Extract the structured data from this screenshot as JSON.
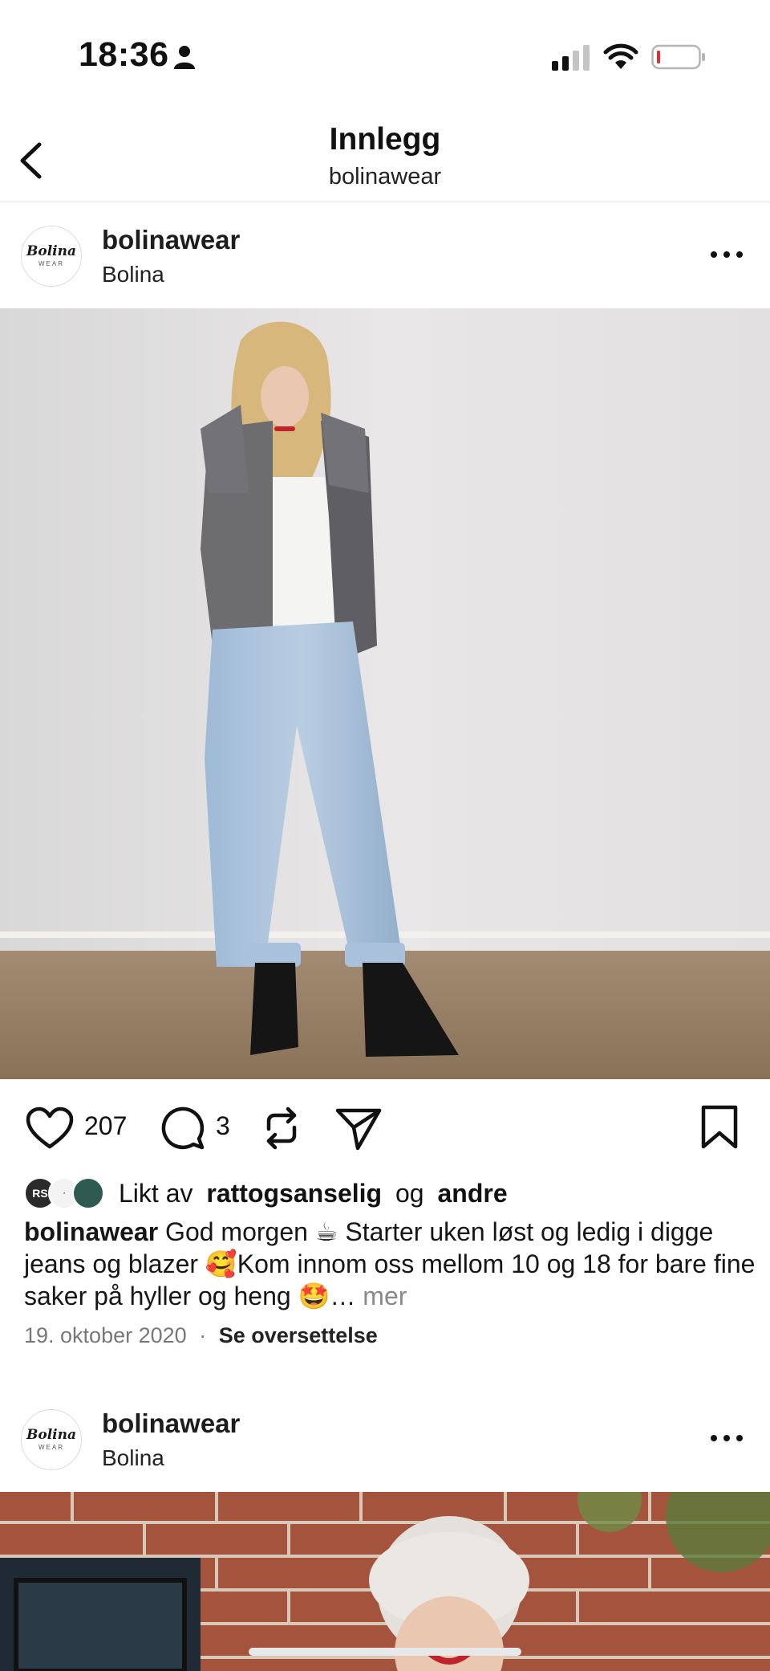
{
  "status_bar": {
    "time": "18:36"
  },
  "header": {
    "title": "Innlegg",
    "subtitle": "bolinawear"
  },
  "posts": [
    {
      "username": "bolinawear",
      "location": "Bolina",
      "avatar_text_main": "Bolina",
      "avatar_text_sub": "WEAR",
      "likes_count": "207",
      "comments_count": "3",
      "liked_by_prefix": "Likt av",
      "liked_by_user": "rattogsanselig",
      "liked_by_and": "og",
      "liked_by_others": "andre",
      "liked_avatar_initials": "RS",
      "caption_user": "bolinawear",
      "caption_text": "God morgen ☕ Starter uken løst og ledig i digge jeans og blazer 🥰Kom innom oss mellom 10 og 18 for bare fine saker på hyller og heng 🤩…",
      "caption_more": "mer",
      "date": "19. oktober 2020",
      "separator": "·",
      "translate": "Se oversettelse"
    },
    {
      "username": "bolinawear",
      "location": "Bolina",
      "avatar_text_main": "Bolina",
      "avatar_text_sub": "WEAR"
    }
  ],
  "icons": [
    "person-icon",
    "signal-icon",
    "wifi-icon",
    "battery-icon",
    "back-arrow-icon",
    "more-icon",
    "heart-icon",
    "comment-icon",
    "repost-icon",
    "send-icon",
    "bookmark-icon"
  ],
  "colors": {
    "battery_low": "#e0302f",
    "secondary_text": "#8a8a8a"
  }
}
